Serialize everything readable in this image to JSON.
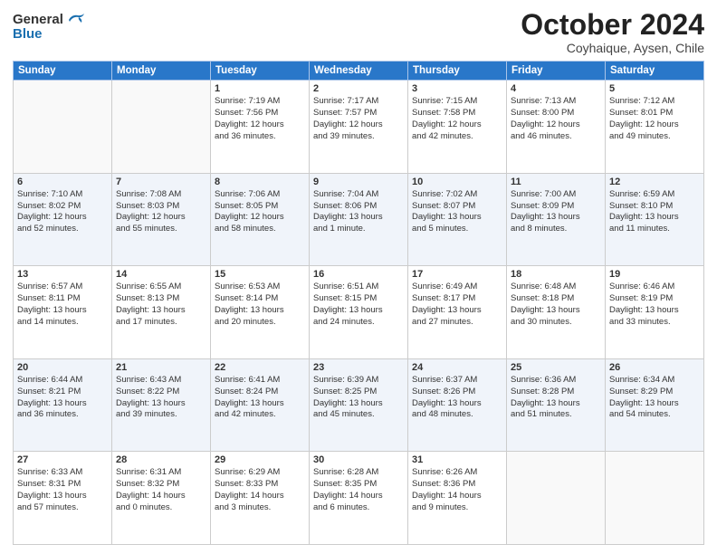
{
  "header": {
    "logo_general": "General",
    "logo_blue": "Blue",
    "month": "October 2024",
    "location": "Coyhaique, Aysen, Chile"
  },
  "weekdays": [
    "Sunday",
    "Monday",
    "Tuesday",
    "Wednesday",
    "Thursday",
    "Friday",
    "Saturday"
  ],
  "weeks": [
    [
      {
        "day": "",
        "info": ""
      },
      {
        "day": "",
        "info": ""
      },
      {
        "day": "1",
        "info": "Sunrise: 7:19 AM\nSunset: 7:56 PM\nDaylight: 12 hours\nand 36 minutes."
      },
      {
        "day": "2",
        "info": "Sunrise: 7:17 AM\nSunset: 7:57 PM\nDaylight: 12 hours\nand 39 minutes."
      },
      {
        "day": "3",
        "info": "Sunrise: 7:15 AM\nSunset: 7:58 PM\nDaylight: 12 hours\nand 42 minutes."
      },
      {
        "day": "4",
        "info": "Sunrise: 7:13 AM\nSunset: 8:00 PM\nDaylight: 12 hours\nand 46 minutes."
      },
      {
        "day": "5",
        "info": "Sunrise: 7:12 AM\nSunset: 8:01 PM\nDaylight: 12 hours\nand 49 minutes."
      }
    ],
    [
      {
        "day": "6",
        "info": "Sunrise: 7:10 AM\nSunset: 8:02 PM\nDaylight: 12 hours\nand 52 minutes."
      },
      {
        "day": "7",
        "info": "Sunrise: 7:08 AM\nSunset: 8:03 PM\nDaylight: 12 hours\nand 55 minutes."
      },
      {
        "day": "8",
        "info": "Sunrise: 7:06 AM\nSunset: 8:05 PM\nDaylight: 12 hours\nand 58 minutes."
      },
      {
        "day": "9",
        "info": "Sunrise: 7:04 AM\nSunset: 8:06 PM\nDaylight: 13 hours\nand 1 minute."
      },
      {
        "day": "10",
        "info": "Sunrise: 7:02 AM\nSunset: 8:07 PM\nDaylight: 13 hours\nand 5 minutes."
      },
      {
        "day": "11",
        "info": "Sunrise: 7:00 AM\nSunset: 8:09 PM\nDaylight: 13 hours\nand 8 minutes."
      },
      {
        "day": "12",
        "info": "Sunrise: 6:59 AM\nSunset: 8:10 PM\nDaylight: 13 hours\nand 11 minutes."
      }
    ],
    [
      {
        "day": "13",
        "info": "Sunrise: 6:57 AM\nSunset: 8:11 PM\nDaylight: 13 hours\nand 14 minutes."
      },
      {
        "day": "14",
        "info": "Sunrise: 6:55 AM\nSunset: 8:13 PM\nDaylight: 13 hours\nand 17 minutes."
      },
      {
        "day": "15",
        "info": "Sunrise: 6:53 AM\nSunset: 8:14 PM\nDaylight: 13 hours\nand 20 minutes."
      },
      {
        "day": "16",
        "info": "Sunrise: 6:51 AM\nSunset: 8:15 PM\nDaylight: 13 hours\nand 24 minutes."
      },
      {
        "day": "17",
        "info": "Sunrise: 6:49 AM\nSunset: 8:17 PM\nDaylight: 13 hours\nand 27 minutes."
      },
      {
        "day": "18",
        "info": "Sunrise: 6:48 AM\nSunset: 8:18 PM\nDaylight: 13 hours\nand 30 minutes."
      },
      {
        "day": "19",
        "info": "Sunrise: 6:46 AM\nSunset: 8:19 PM\nDaylight: 13 hours\nand 33 minutes."
      }
    ],
    [
      {
        "day": "20",
        "info": "Sunrise: 6:44 AM\nSunset: 8:21 PM\nDaylight: 13 hours\nand 36 minutes."
      },
      {
        "day": "21",
        "info": "Sunrise: 6:43 AM\nSunset: 8:22 PM\nDaylight: 13 hours\nand 39 minutes."
      },
      {
        "day": "22",
        "info": "Sunrise: 6:41 AM\nSunset: 8:24 PM\nDaylight: 13 hours\nand 42 minutes."
      },
      {
        "day": "23",
        "info": "Sunrise: 6:39 AM\nSunset: 8:25 PM\nDaylight: 13 hours\nand 45 minutes."
      },
      {
        "day": "24",
        "info": "Sunrise: 6:37 AM\nSunset: 8:26 PM\nDaylight: 13 hours\nand 48 minutes."
      },
      {
        "day": "25",
        "info": "Sunrise: 6:36 AM\nSunset: 8:28 PM\nDaylight: 13 hours\nand 51 minutes."
      },
      {
        "day": "26",
        "info": "Sunrise: 6:34 AM\nSunset: 8:29 PM\nDaylight: 13 hours\nand 54 minutes."
      }
    ],
    [
      {
        "day": "27",
        "info": "Sunrise: 6:33 AM\nSunset: 8:31 PM\nDaylight: 13 hours\nand 57 minutes."
      },
      {
        "day": "28",
        "info": "Sunrise: 6:31 AM\nSunset: 8:32 PM\nDaylight: 14 hours\nand 0 minutes."
      },
      {
        "day": "29",
        "info": "Sunrise: 6:29 AM\nSunset: 8:33 PM\nDaylight: 14 hours\nand 3 minutes."
      },
      {
        "day": "30",
        "info": "Sunrise: 6:28 AM\nSunset: 8:35 PM\nDaylight: 14 hours\nand 6 minutes."
      },
      {
        "day": "31",
        "info": "Sunrise: 6:26 AM\nSunset: 8:36 PM\nDaylight: 14 hours\nand 9 minutes."
      },
      {
        "day": "",
        "info": ""
      },
      {
        "day": "",
        "info": ""
      }
    ]
  ]
}
